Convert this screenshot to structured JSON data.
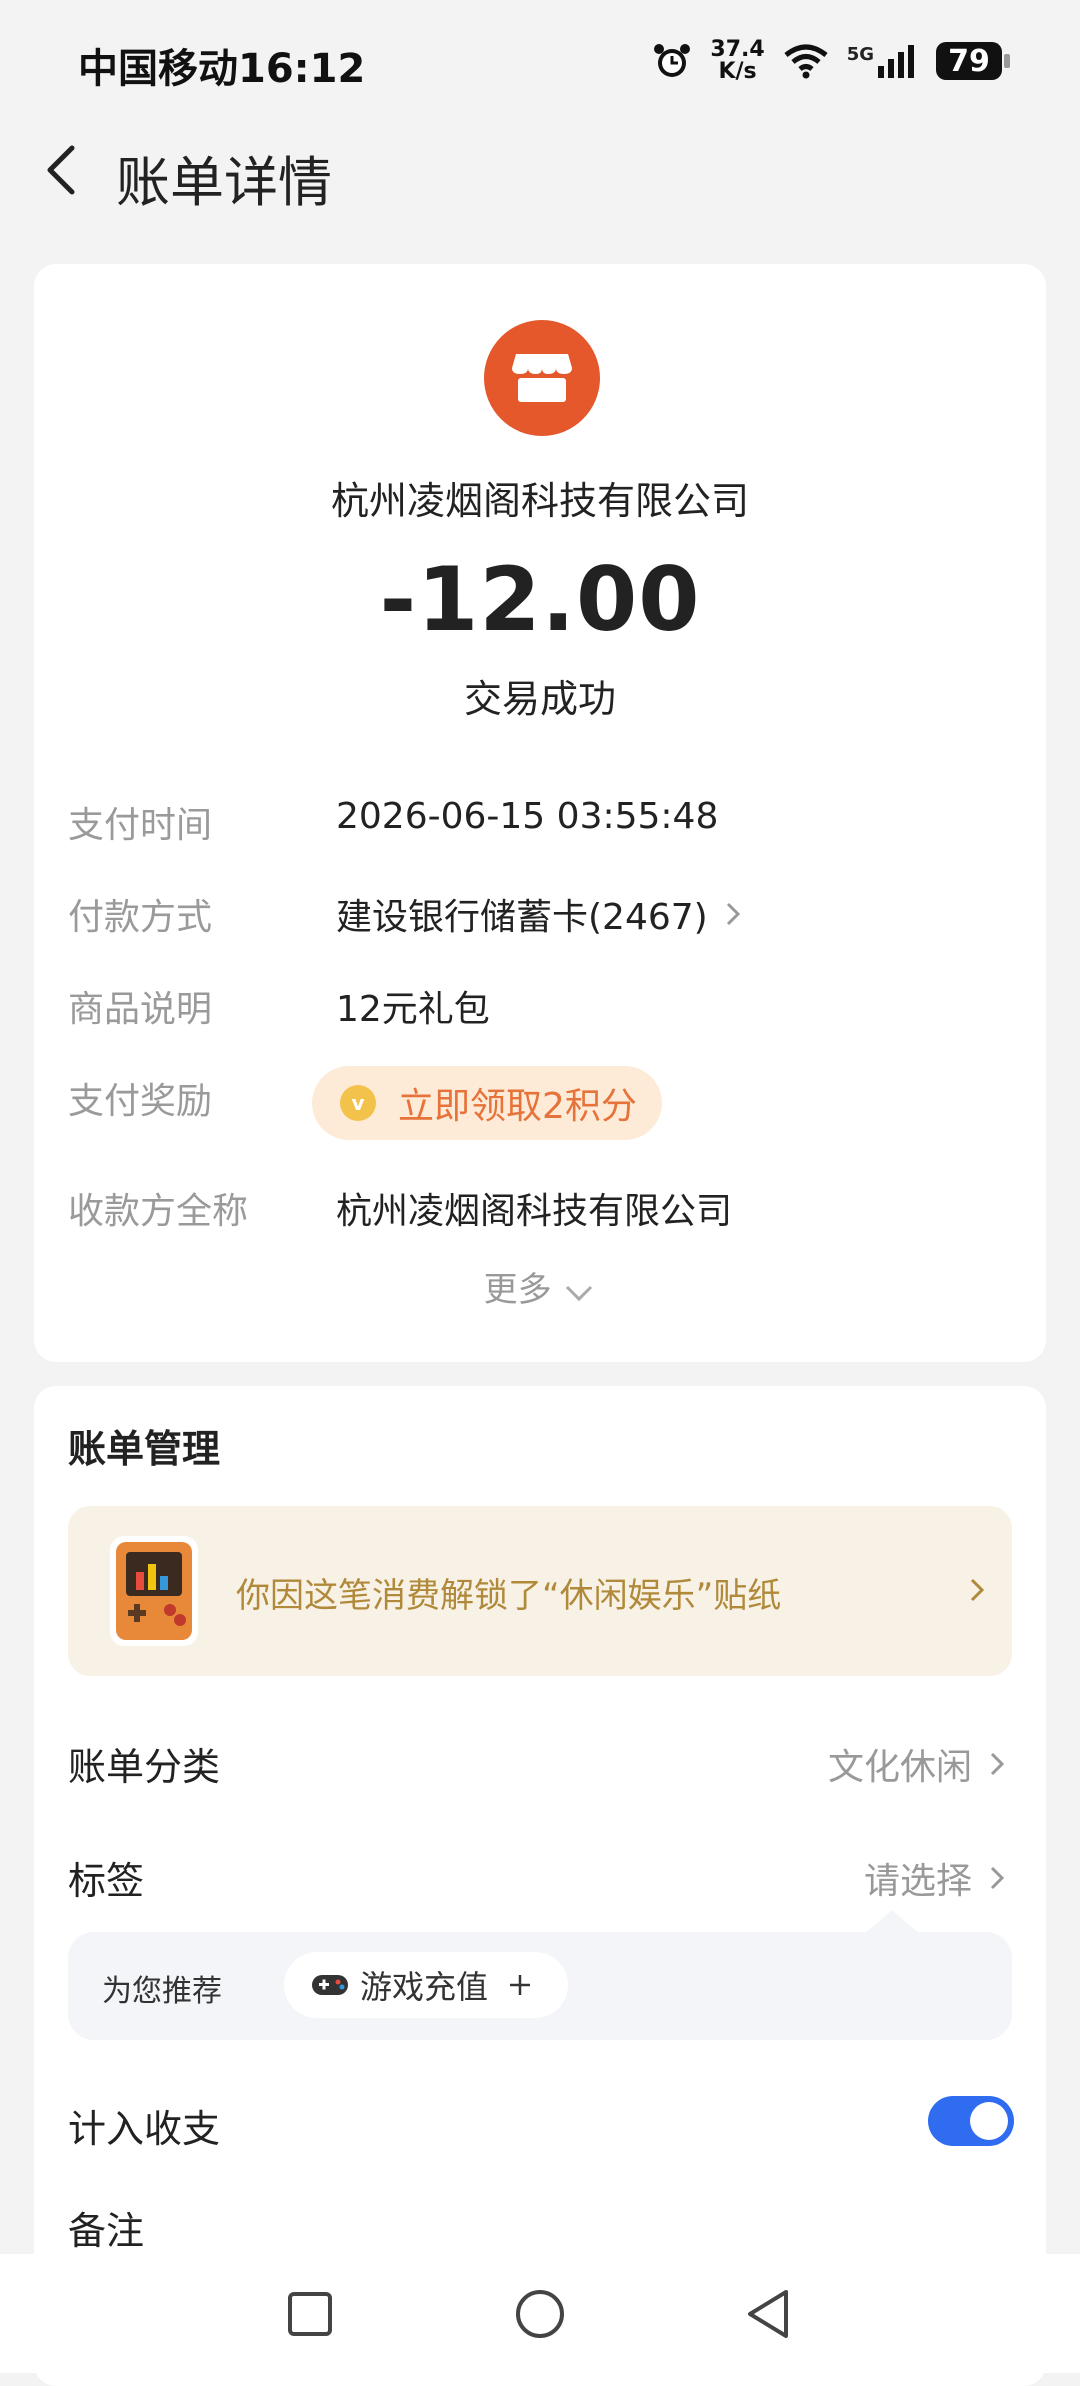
{
  "status_bar": {
    "carrier_time": "中国移动16:12",
    "net_speed_value": "37.4",
    "net_speed_unit": "K/s",
    "network": "5G",
    "battery": "79"
  },
  "header": {
    "title": "账单详情",
    "back_icon": "chevron-left-icon"
  },
  "transaction": {
    "merchant_icon": "store-icon",
    "merchant_name": "杭州凌烟阁科技有限公司",
    "amount": "-12.00",
    "status": "交易成功"
  },
  "details": {
    "pay_time_label": "支付时间",
    "pay_time_value": "2026-06-15 03:55:48",
    "method_label": "付款方式",
    "method_value": "建设银行储蓄卡(2467)",
    "goods_label": "商品说明",
    "goods_value": "12元礼包",
    "reward_label": "支付奖励",
    "reward_value": "立即领取2积分",
    "payee_label": "收款方全称",
    "payee_value": "杭州凌烟阁科技有限公司",
    "more_label": "更多"
  },
  "management": {
    "title": "账单管理",
    "sticker_text": "你因这笔消费解锁了“休闲娱乐”贴纸",
    "category_label": "账单分类",
    "category_value": "文化休闲",
    "tag_label": "标签",
    "tag_value": "请选择",
    "recommend_label": "为您推荐",
    "recommend_chip": "游戏充值",
    "include_label": "计入收支",
    "include_on": true,
    "note_label": "备注"
  },
  "colors": {
    "accent": "#2f6cf0",
    "merchant": "#e5582b",
    "reward": "#e6733a"
  }
}
